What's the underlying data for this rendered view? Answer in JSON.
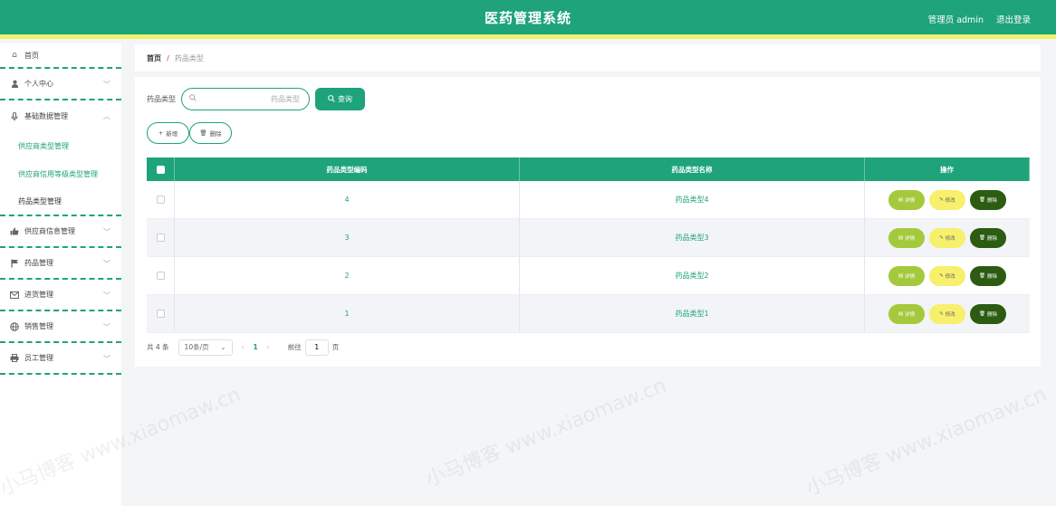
{
  "header": {
    "title": "医药管理系统",
    "user": "管理员 admin",
    "logout": "退出登录"
  },
  "sidebar": {
    "items": [
      {
        "label": "首页",
        "icon": "home-icon"
      },
      {
        "label": "个人中心",
        "icon": "user-icon"
      },
      {
        "label": "基础数据管理",
        "icon": "mic-icon"
      },
      {
        "label": "供应商信息管理",
        "icon": "thumb-icon"
      },
      {
        "label": "药品管理",
        "icon": "flag-icon"
      },
      {
        "label": "进货管理",
        "icon": "mail-icon"
      },
      {
        "label": "销售管理",
        "icon": "globe-icon"
      },
      {
        "label": "员工管理",
        "icon": "printer-icon"
      }
    ],
    "subitems": [
      {
        "label": "供应商类型管理"
      },
      {
        "label": "供应商信用等级类型管理"
      },
      {
        "label": "药品类型管理"
      }
    ]
  },
  "breadcrumb": {
    "home": "首页",
    "sep": "/",
    "current": "药品类型"
  },
  "search": {
    "label": "药品类型",
    "placeholder": "药品类型",
    "button": "查询"
  },
  "actions": {
    "add": "新增",
    "delete": "删除"
  },
  "table": {
    "headers": [
      "药品类型编码",
      "药品类型名称",
      "操作"
    ],
    "rows": [
      {
        "code": "4",
        "name": "药品类型4"
      },
      {
        "code": "3",
        "name": "药品类型3"
      },
      {
        "code": "2",
        "name": "药品类型2"
      },
      {
        "code": "1",
        "name": "药品类型1"
      }
    ],
    "ops": {
      "detail": "详情",
      "edit": "修改",
      "delete": "删除"
    }
  },
  "pager": {
    "total": "共 4 条",
    "page_size": "10条/页",
    "current_page": "1",
    "goto_label": "前往",
    "goto_value": "1",
    "goto_unit": "页"
  },
  "watermark": "小马博客 www.xiaomaw.cn",
  "colors": {
    "primary": "#1ea37a",
    "accent_bar": "#ecf26a",
    "detail": "#a5c93d",
    "edit": "#f6f06c",
    "delete": "#2b5c12"
  }
}
